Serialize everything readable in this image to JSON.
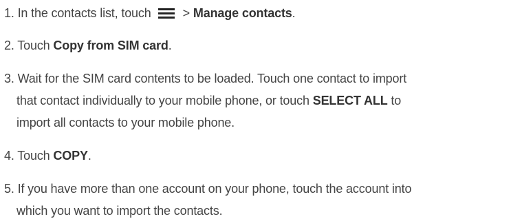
{
  "steps": [
    {
      "number": "1.",
      "pre": " In the contacts list, touch",
      "icon": "menu-icon",
      "mid": "> ",
      "bold": "Manage contacts",
      "post": "."
    },
    {
      "number": "2.",
      "pre": " Touch ",
      "bold": "Copy from SIM card",
      "post": "."
    },
    {
      "number": "3.",
      "line1": " Wait for the SIM card contents to be loaded. Touch one contact to import",
      "line2_pre": "that contact individually to your mobile phone, or touch ",
      "line2_bold": "SELECT ALL",
      "line2_post": " to",
      "line3": "import all contacts to your mobile phone."
    },
    {
      "number": "4.",
      "pre": " Touch ",
      "bold": "COPY",
      "post": "."
    },
    {
      "number": "5.",
      "line1": " If you have more than one account on your phone, touch the account into",
      "line2": "which you want to import the contacts."
    }
  ]
}
